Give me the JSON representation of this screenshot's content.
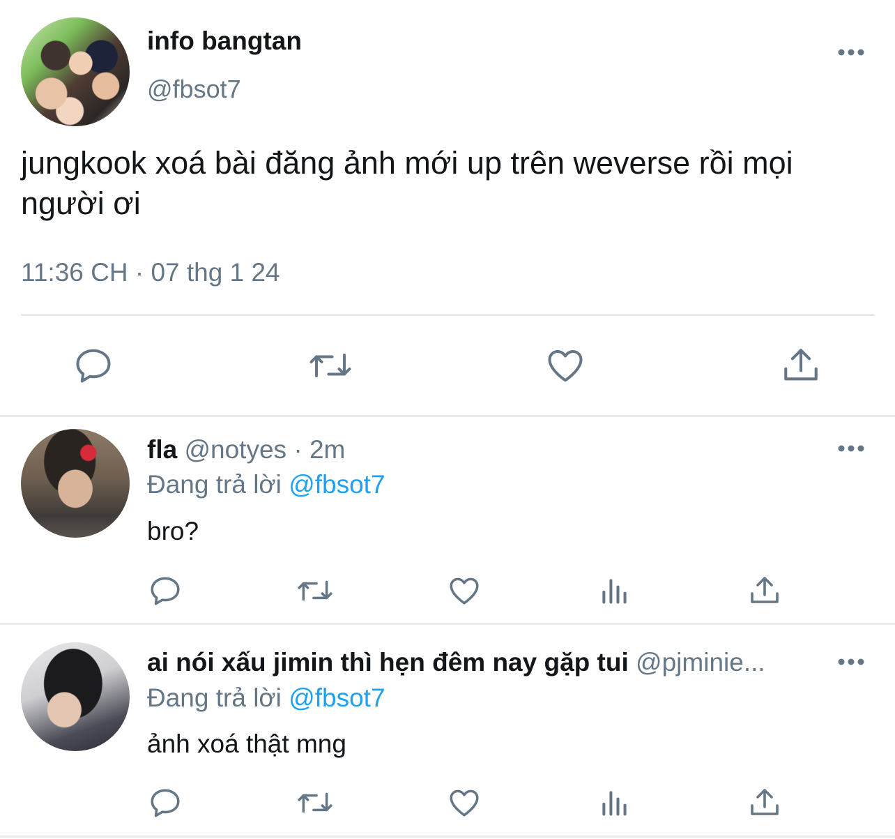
{
  "main_tweet": {
    "display_name": "info bangtan",
    "handle": "@fbsot7",
    "text": "jungkook xoá bài đăng ảnh mới up trên weverse rồi mọi người ơi",
    "timestamp": "11:36 CH · 07 thg 1 24",
    "actions": [
      "reply-icon",
      "retweet-icon",
      "like-icon",
      "share-icon"
    ]
  },
  "replies": [
    {
      "display_name": "fla",
      "handle": "@notyes",
      "separator": "·",
      "time": "2m",
      "replying_prefix": "Đang trả lời",
      "replying_to": "@fbsot7",
      "text": "bro?"
    },
    {
      "display_name": "ai nói xấu jimin thì hẹn đêm nay gặp tui",
      "handle": "@pjminie...",
      "replying_prefix": "Đang trả lời",
      "replying_to": "@fbsot7",
      "text": "ảnh xoá thật mng"
    }
  ],
  "colors": {
    "text_primary": "#14171a",
    "text_secondary": "#657786",
    "mention": "#1da1f2",
    "divider": "#e6ecf0"
  }
}
